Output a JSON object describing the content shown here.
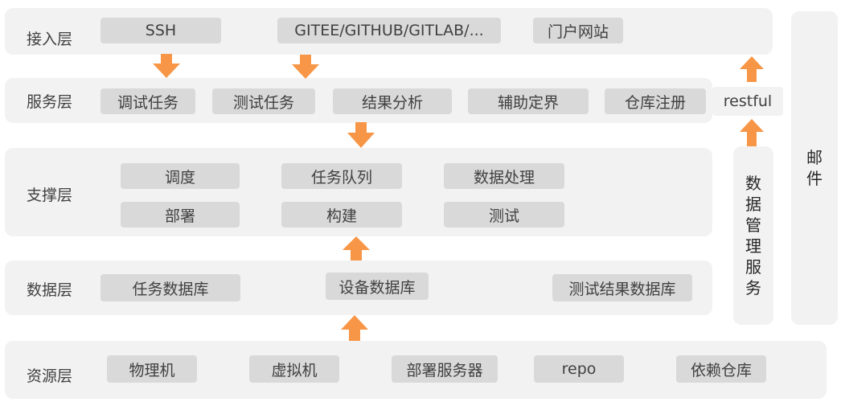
{
  "access_layer": {
    "label": "接入层",
    "items": [
      "SSH",
      "GITEE/GITHUB/GITLAB/...",
      "门户网站"
    ]
  },
  "service_layer": {
    "label": "服务层",
    "items": [
      "调试任务",
      "测试任务",
      "结果分析",
      "辅助定界",
      "仓库注册"
    ]
  },
  "restful": "restful",
  "support_layer": {
    "label": "支撑层",
    "items": [
      "调度",
      "任务队列",
      "数据处理",
      "部署",
      "构建",
      "测试"
    ]
  },
  "data_layer": {
    "label": "数据层",
    "items": [
      "任务数据库",
      "设备数据库",
      "测试结果数据库"
    ]
  },
  "resource_layer": {
    "label": "资源层",
    "items": [
      "物理机",
      "虚拟机",
      "部署服务器",
      "repo",
      "依赖仓库"
    ]
  },
  "data_mgmt_service": [
    "数",
    "据",
    "管",
    "理",
    "服",
    "务"
  ],
  "mail": [
    "邮",
    "件"
  ],
  "colors": {
    "layer_bg": "#f2f2f2",
    "box_bg": "#d9d9d9",
    "arrow": "#f79646"
  }
}
